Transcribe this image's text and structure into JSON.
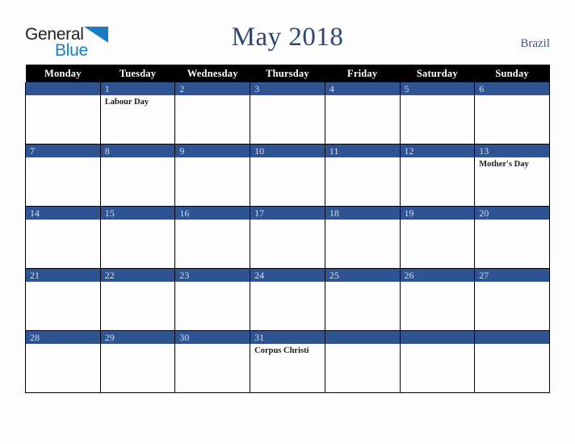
{
  "brand": {
    "word_general": "General",
    "word_blue": "Blue",
    "triangle_color": "#1b7dc1",
    "general_color": "#231f20",
    "blue_color": "#1b7dc1"
  },
  "header": {
    "title": "May 2018",
    "country": "Brazil",
    "title_color": "#2c4675",
    "country_color": "#3f5680"
  },
  "calendar": {
    "month": "May",
    "year": "2018",
    "header_bg": "#000000",
    "header_text_color": "#ffffff",
    "daybar_bg": "#2e5494",
    "daybar_text_color": "#d8dde8",
    "cell_bg": "#fdfdfd",
    "border_color": "#000000",
    "weekdays": [
      "Monday",
      "Tuesday",
      "Wednesday",
      "Thursday",
      "Friday",
      "Saturday",
      "Sunday"
    ],
    "weeks": [
      [
        {
          "day": "",
          "events": []
        },
        {
          "day": "1",
          "events": [
            "Labour Day"
          ]
        },
        {
          "day": "2",
          "events": []
        },
        {
          "day": "3",
          "events": []
        },
        {
          "day": "4",
          "events": []
        },
        {
          "day": "5",
          "events": []
        },
        {
          "day": "6",
          "events": []
        }
      ],
      [
        {
          "day": "7",
          "events": []
        },
        {
          "day": "8",
          "events": []
        },
        {
          "day": "9",
          "events": []
        },
        {
          "day": "10",
          "events": []
        },
        {
          "day": "11",
          "events": []
        },
        {
          "day": "12",
          "events": []
        },
        {
          "day": "13",
          "events": [
            "Mother's Day"
          ]
        }
      ],
      [
        {
          "day": "14",
          "events": []
        },
        {
          "day": "15",
          "events": []
        },
        {
          "day": "16",
          "events": []
        },
        {
          "day": "17",
          "events": []
        },
        {
          "day": "18",
          "events": []
        },
        {
          "day": "19",
          "events": []
        },
        {
          "day": "20",
          "events": []
        }
      ],
      [
        {
          "day": "21",
          "events": []
        },
        {
          "day": "22",
          "events": []
        },
        {
          "day": "23",
          "events": []
        },
        {
          "day": "24",
          "events": []
        },
        {
          "day": "25",
          "events": []
        },
        {
          "day": "26",
          "events": []
        },
        {
          "day": "27",
          "events": []
        }
      ],
      [
        {
          "day": "28",
          "events": []
        },
        {
          "day": "29",
          "events": []
        },
        {
          "day": "30",
          "events": []
        },
        {
          "day": "31",
          "events": [
            "Corpus Christi"
          ]
        },
        {
          "day": "",
          "events": []
        },
        {
          "day": "",
          "events": []
        },
        {
          "day": "",
          "events": []
        }
      ]
    ]
  }
}
